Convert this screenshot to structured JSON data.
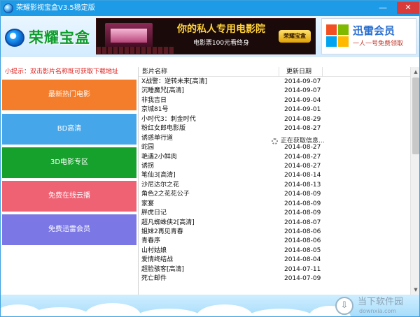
{
  "window": {
    "title": "荣耀影视宝盒V3.5稳定版",
    "minimize_glyph": "—",
    "close_glyph": "✕"
  },
  "header": {
    "logo_text": "荣耀宝盒",
    "ad_cinema": {
      "title": "你的私人专用电影院",
      "subtitle": "电影票100元看终身",
      "badge": "荣耀宝盒"
    },
    "ad_xunlei": {
      "title": "迅雷会员",
      "subtitle": "一人一号免费领取"
    }
  },
  "sidebar": {
    "tip": "小提示：双击影片名称既可获取下载地址",
    "items": [
      {
        "label": "最新热门电影",
        "color": "#f47d2c"
      },
      {
        "label": "BD高清",
        "color": "#45a6ea"
      },
      {
        "label": "3D电影专区",
        "color": "#16a12c"
      },
      {
        "label": "免费在线云播",
        "color": "#ee6274"
      },
      {
        "label": "免费迅雷会员",
        "color": "#7b78e6"
      }
    ]
  },
  "movie_list": {
    "columns": {
      "name": "影片名称",
      "date": "更新日期"
    },
    "loading_text": "正在获取信息...",
    "rows": [
      {
        "name": "X战警：逆转未来[高清]",
        "date": "2014-09-07"
      },
      {
        "name": "沉睡魔咒[高清]",
        "date": "2014-09-07"
      },
      {
        "name": "非我吉日",
        "date": "2014-09-04"
      },
      {
        "name": "京城81号",
        "date": "2014-09-01"
      },
      {
        "name": "小时代3：刺金时代",
        "date": "2014-08-29"
      },
      {
        "name": "粉红女郎电影版",
        "date": "2014-08-27"
      },
      {
        "name": "诱惑单行道",
        "date": ""
      },
      {
        "name": "蛇园",
        "date": "2014-08-27"
      },
      {
        "name": "艳遇2小鲜肉",
        "date": "2014-08-27"
      },
      {
        "name": "诱拐",
        "date": "2014-08-27"
      },
      {
        "name": "笔仙3[高清]",
        "date": "2014-08-14"
      },
      {
        "name": "沙尼达尔之花",
        "date": "2014-08-13"
      },
      {
        "name": "角色2之花花公子",
        "date": "2014-08-09"
      },
      {
        "name": "家宴",
        "date": "2014-08-09"
      },
      {
        "name": "胖虎日记",
        "date": "2014-08-09"
      },
      {
        "name": "超凡蜘蛛侠2[高清]",
        "date": "2014-08-07"
      },
      {
        "name": "姐妹2再见青春",
        "date": "2014-08-06"
      },
      {
        "name": "青春序",
        "date": "2014-08-06"
      },
      {
        "name": "山村姑娘",
        "date": "2014-08-05"
      },
      {
        "name": "爱情终结战",
        "date": "2014-08-04"
      },
      {
        "name": "超脸骇客[高清]",
        "date": "2014-07-11"
      },
      {
        "name": "死亡邮件",
        "date": "2014-07-09"
      }
    ]
  },
  "watermark": {
    "title": "当下软件园",
    "url": "downxia.com",
    "glyph": "⇩"
  }
}
